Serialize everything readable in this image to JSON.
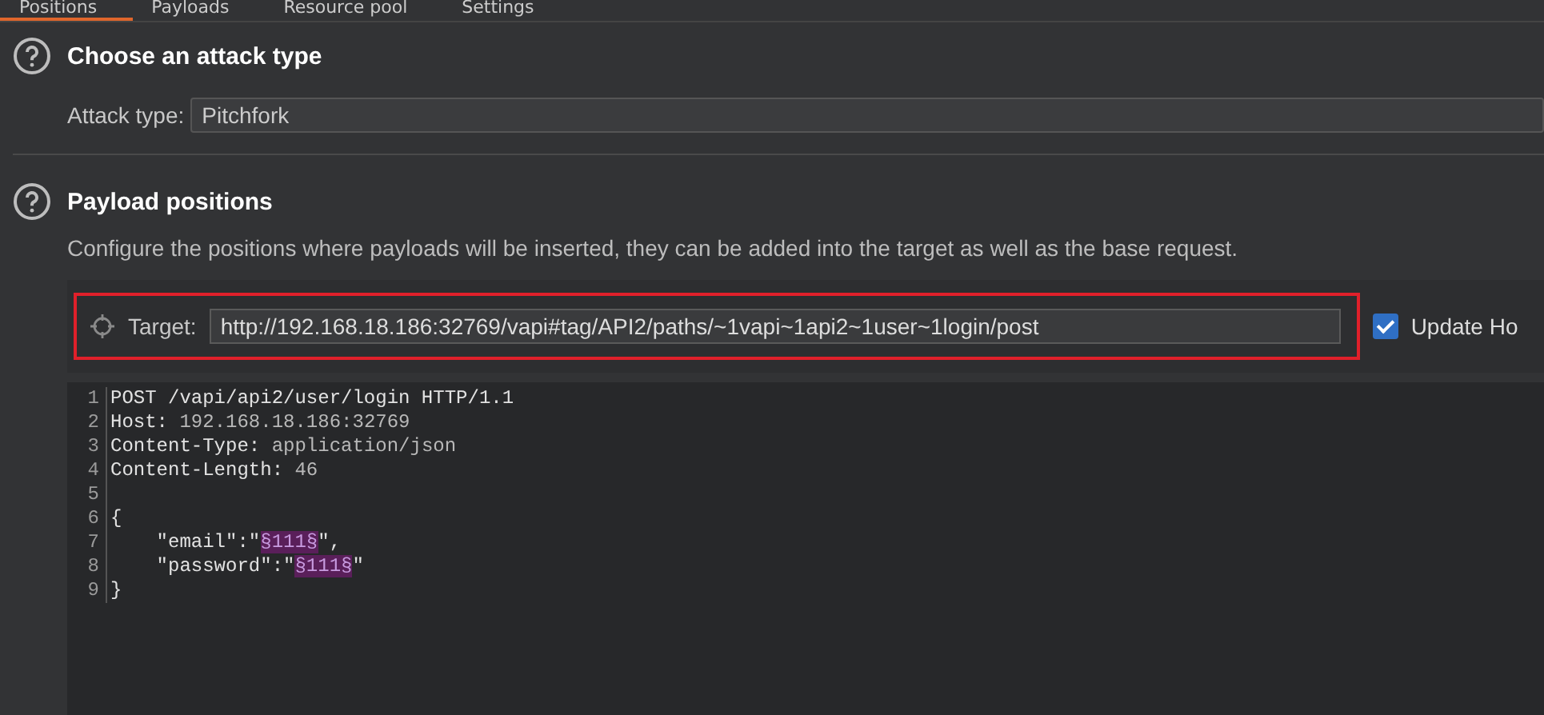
{
  "tabs": [
    {
      "label": "Positions",
      "selected": true
    },
    {
      "label": "Payloads",
      "selected": false
    },
    {
      "label": "Resource pool",
      "selected": false
    },
    {
      "label": "Settings",
      "selected": false
    }
  ],
  "attack_section": {
    "title": "Choose an attack type",
    "field_label": "Attack type:",
    "value": "Pitchfork"
  },
  "positions_section": {
    "title": "Payload positions",
    "description": "Configure the positions where payloads will be inserted, they can be added into the target as well as the base request.",
    "target": {
      "label": "Target:",
      "value": "http://192.168.18.186:32769/vapi#tag/API2/paths/~1vapi~1api2~1user~1login/post",
      "highlighted": true
    },
    "update_host": {
      "label": "Update Ho",
      "checked": true
    }
  },
  "editor": {
    "lines": [
      {
        "number": "1",
        "segments": [
          {
            "kind": "name",
            "text": "POST /vapi/api2/user/login HTTP/1.1"
          }
        ]
      },
      {
        "number": "2",
        "segments": [
          {
            "kind": "name",
            "text": "Host: "
          },
          {
            "kind": "value",
            "text": "192.168.18.186:32769"
          }
        ]
      },
      {
        "number": "3",
        "segments": [
          {
            "kind": "name",
            "text": "Content-Type: "
          },
          {
            "kind": "value",
            "text": "application/json"
          }
        ]
      },
      {
        "number": "4",
        "segments": [
          {
            "kind": "name",
            "text": "Content-Length: "
          },
          {
            "kind": "value",
            "text": "46"
          }
        ]
      },
      {
        "number": "5"
      },
      {
        "number": "6",
        "segments": [
          {
            "kind": "name",
            "text": "{"
          }
        ]
      },
      {
        "number": "7",
        "segments": [
          {
            "kind": "name",
            "text": "    \"email\":\""
          },
          {
            "kind": "payload",
            "text": "§111§"
          },
          {
            "kind": "name",
            "text": "\","
          }
        ]
      },
      {
        "number": "8",
        "segments": [
          {
            "kind": "name",
            "text": "    \"password\":\""
          },
          {
            "kind": "payload",
            "text": "§111§"
          },
          {
            "kind": "name",
            "text": "\""
          }
        ]
      },
      {
        "number": "9",
        "segments": [
          {
            "kind": "name",
            "text": "}"
          }
        ]
      }
    ]
  }
}
